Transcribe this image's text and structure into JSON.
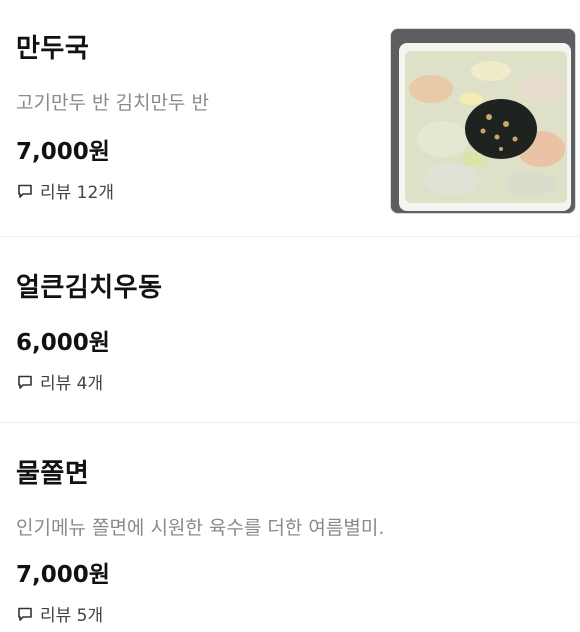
{
  "menu": {
    "items": [
      {
        "name": "만두국",
        "description": "고기만두 반 김치만두 반",
        "price": "7,000원",
        "review": "리뷰 12개",
        "photo_icon": "food-photo-icon"
      },
      {
        "name": "얼큰김치우동",
        "price": "6,000원",
        "review": "리뷰 4개"
      },
      {
        "name": "물쫄면",
        "description": "인기메뉴 쫄면에 시원한 육수를 더한 여름별미.",
        "price": "7,000원",
        "review": "리뷰 5개"
      }
    ],
    "review_icon": "speech-bubble-icon"
  }
}
